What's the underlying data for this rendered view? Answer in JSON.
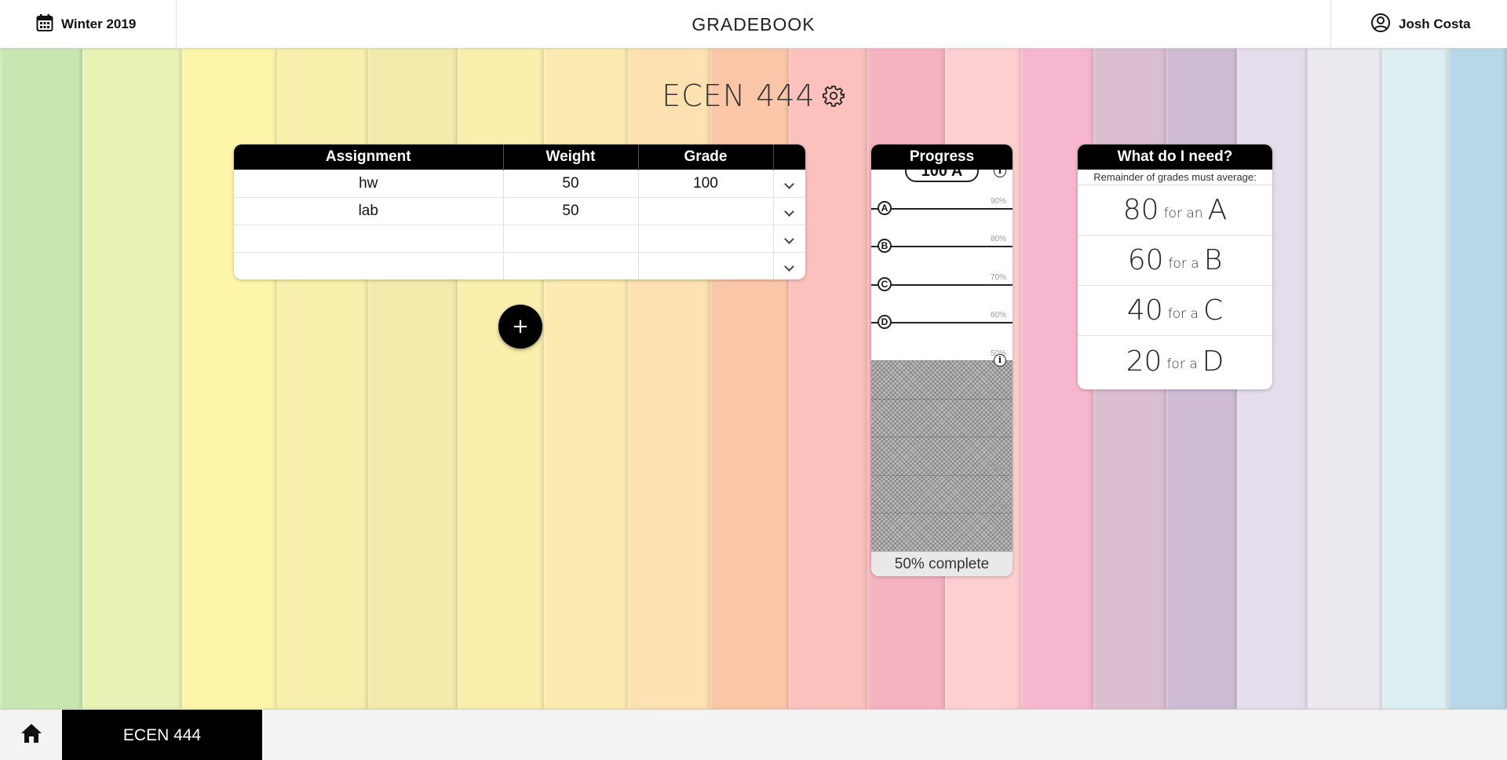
{
  "header": {
    "term_label": "Winter 2019",
    "title": "GRADEBOOK",
    "user_name": "Josh Costa",
    "term_icon": "calendar-icon",
    "user_icon": "user-circle-icon"
  },
  "course": {
    "title": "ECEN 444",
    "settings_icon": "gear-icon"
  },
  "table": {
    "headers": [
      "Assignment",
      "Weight",
      "Grade"
    ],
    "rows": [
      {
        "assignment": "hw",
        "weight": "50",
        "grade": "100"
      },
      {
        "assignment": "lab",
        "weight": "50",
        "grade": ""
      },
      {
        "assignment": "",
        "weight": "",
        "grade": ""
      },
      {
        "assignment": "",
        "weight": "",
        "grade": ""
      }
    ],
    "row_menu_icon": "chevron-down-icon"
  },
  "add_button": {
    "label": "+"
  },
  "progress": {
    "title": "Progress",
    "current_grade": "100 A",
    "completion": 0.5,
    "footer": "50% complete",
    "grade_lines": [
      {
        "letter": "A",
        "percent": "90%"
      },
      {
        "letter": "B",
        "percent": "80%"
      },
      {
        "letter": "C",
        "percent": "70%"
      },
      {
        "letter": "D",
        "percent": "60%"
      }
    ],
    "lower_percents": [
      "50%",
      "40%",
      "30%",
      "20%",
      "10%"
    ],
    "info_icon": "info-icon"
  },
  "need": {
    "title": "What do I need?",
    "subtitle": "Remainder of grades must average:",
    "rows": [
      {
        "value": "80",
        "for_text": "for an",
        "letter": "A"
      },
      {
        "value": "60",
        "for_text": "for a",
        "letter": "B"
      },
      {
        "value": "40",
        "for_text": "for a",
        "letter": "C"
      },
      {
        "value": "20",
        "for_text": "for a",
        "letter": "D"
      }
    ]
  },
  "bottom_nav": {
    "home_icon": "home-icon",
    "course_tab": "ECEN 444"
  },
  "colors": {
    "stripes": [
      "#c8e6b0",
      "#e8f2b4",
      "#fdf5a8",
      "#f8efac",
      "#f2ebab",
      "#fbefae",
      "#fcebb0",
      "#fde1b0",
      "#fcc7a8",
      "#fcc1bc",
      "#f5b3c0",
      "#fecfd0",
      "#f7b6cf",
      "#dbbfd0",
      "#cdbcd4",
      "#e5dcec",
      "#ebe8f0",
      "#ddeff2",
      "#b6d8e8"
    ],
    "accent": "#000000"
  }
}
